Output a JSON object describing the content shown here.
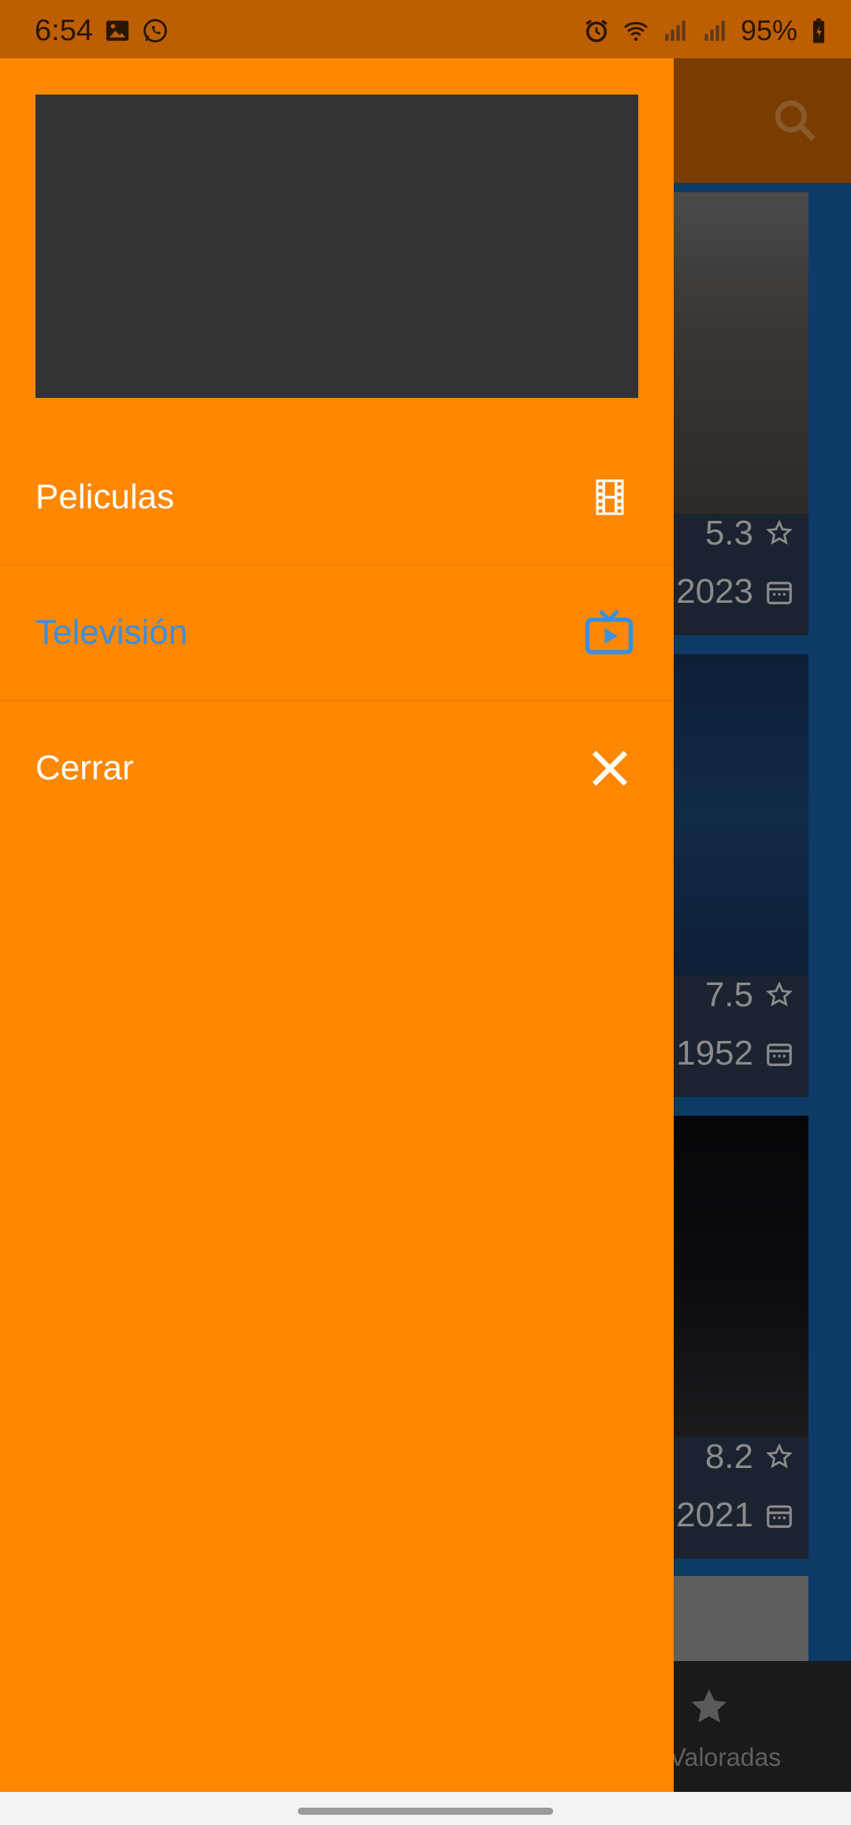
{
  "status_bar": {
    "time": "6:54",
    "battery": "95%"
  },
  "app": {
    "cards": [
      {
        "rating": "5.3",
        "year": "2023"
      },
      {
        "rating": "7.5",
        "year": "1952"
      },
      {
        "rating": "8.2",
        "year": "2021"
      }
    ],
    "bottom_nav_label": "r Valoradas"
  },
  "drawer": {
    "items": [
      {
        "label": "Peliculas",
        "icon": "film-icon"
      },
      {
        "label": "Televisión",
        "icon": "tv-play-icon",
        "active": true
      },
      {
        "label": "Cerrar",
        "icon": "close-icon"
      }
    ]
  },
  "colors": {
    "drawer_bg": "#ff8800",
    "active_item": "#3a8fe0",
    "header_placeholder": "#333333"
  }
}
